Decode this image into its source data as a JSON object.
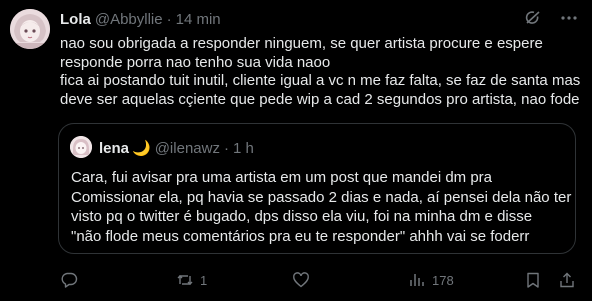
{
  "author": {
    "display_name": "Lola",
    "handle": "@Abbyllie",
    "time": "14 min"
  },
  "tweet_lines": [
    "nao sou obrigada a responder ninguem, se quer artista procure e espere",
    "responde porra nao tenho sua vida naoo",
    "fica ai postando tuit inutil, cliente igual a vc n me faz falta, se faz de santa mas",
    "deve ser aquelas cçiente que pede wip a cad 2 segundos pro artista, nao fode"
  ],
  "quoted": {
    "display_name": "lena",
    "emoji": "🌙",
    "handle": "@ilenawz",
    "time": "1 h",
    "lines": [
      "Cara, fui avisar pra uma artista em um post que mandei dm pra",
      "Comissionar ela, pq havia se passado 2 dias e nada, aí pensei dela não ter",
      "visto pq o twitter é bugado, dps disso ela viu, foi na minha dm e disse",
      "\"não flode meus comentários pra eu te responder\" ahhh vai se foderr"
    ]
  },
  "actions": {
    "reply_count": "",
    "retweet_count": "1",
    "like_count": "",
    "views_count": "178"
  },
  "icons": {
    "top": [
      "grok-icon",
      "more-icon"
    ],
    "actions": [
      "reply-icon",
      "retweet-icon",
      "like-icon",
      "views-icon",
      "bookmark-icon",
      "share-icon"
    ]
  },
  "colors": {
    "background": "#000000",
    "text": "#e7e9ea",
    "secondary": "#71767b",
    "border": "#2f3336"
  }
}
